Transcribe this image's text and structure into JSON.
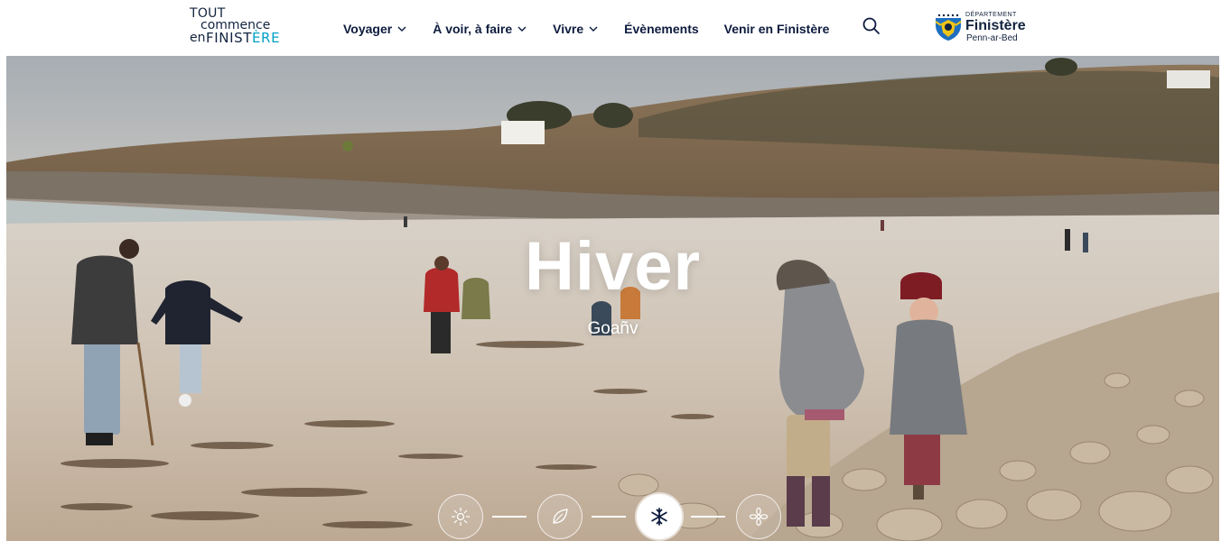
{
  "header": {
    "logo": {
      "line1": "TOUT",
      "line2": "commence",
      "line3_prefix": "en",
      "line3_main": "FINIST",
      "line3_accent": "ÈRE"
    },
    "nav": [
      {
        "label": "Voyager",
        "has_dropdown": true
      },
      {
        "label": "À voir, à faire",
        "has_dropdown": true
      },
      {
        "label": "Vivre",
        "has_dropdown": true
      },
      {
        "label": "Évènements",
        "has_dropdown": false
      },
      {
        "label": "Venir en Finistère",
        "has_dropdown": false
      }
    ],
    "search_icon": "search-icon",
    "department": {
      "small": "DÉPARTEMENT",
      "name": "Finistère",
      "sub": "Penn-ar-Bed"
    }
  },
  "hero": {
    "title": "Hiver",
    "subtitle": "Goañv",
    "seasons": [
      {
        "icon": "sun-icon",
        "active": false
      },
      {
        "icon": "leaf-icon",
        "active": false
      },
      {
        "icon": "snowflake-icon",
        "active": true
      },
      {
        "icon": "flower-icon",
        "active": false
      }
    ]
  },
  "colors": {
    "text": "#0d1b3e",
    "accent": "#00a0c6",
    "hero_text": "#ffffff"
  }
}
